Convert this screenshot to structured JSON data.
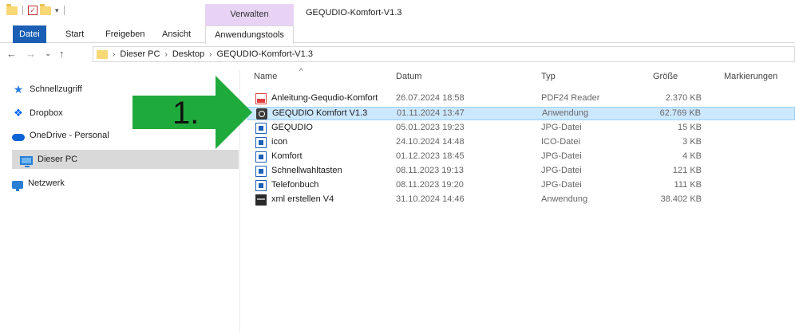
{
  "titlebar": {
    "verwalten": "Verwalten",
    "title": "GEQUDIO-Komfort-V1.3"
  },
  "ribbon": {
    "tabs": [
      "Datei",
      "Start",
      "Freigeben",
      "Ansicht",
      "Anwendungstools"
    ]
  },
  "address": {
    "crumbs": [
      "Dieser PC",
      "Desktop",
      "GEQUDIO-Komfort-V1.3"
    ]
  },
  "sidebar": {
    "items": [
      {
        "label": "Schnellzugriff",
        "icon": "star-icon"
      },
      {
        "label": "Dropbox",
        "icon": "dropbox-icon"
      },
      {
        "label": "OneDrive - Personal",
        "icon": "cloud-icon"
      },
      {
        "label": "Dieser PC",
        "icon": "computer-icon",
        "selected": true
      },
      {
        "label": "Netzwerk",
        "icon": "network-icon"
      }
    ]
  },
  "columns": {
    "name": "Name",
    "date": "Datum",
    "type": "Typ",
    "size": "Größe",
    "tags": "Markierungen"
  },
  "files": [
    {
      "name": "Anleitung-Gequdio-Komfort",
      "date": "26.07.2024 18:58",
      "type": "PDF24 Reader",
      "size": "2.370 KB",
      "icon": "pdf-icon"
    },
    {
      "name": "GEQUDIO Komfort V1.3",
      "date": "01.11.2024 13:47",
      "type": "Anwendung",
      "size": "62.769 KB",
      "icon": "app-icon",
      "selected": true
    },
    {
      "name": "GEQUDIO",
      "date": "05.01.2023 19:23",
      "type": "JPG-Datei",
      "size": "15 KB",
      "icon": "image-icon"
    },
    {
      "name": "icon",
      "date": "24.10.2024 14:48",
      "type": "ICO-Datei",
      "size": "3 KB",
      "icon": "image-icon"
    },
    {
      "name": "Komfort",
      "date": "01.12.2023 18:45",
      "type": "JPG-Datei",
      "size": "4 KB",
      "icon": "image-icon"
    },
    {
      "name": "Schnellwahltasten",
      "date": "08.11.2023 19:13",
      "type": "JPG-Datei",
      "size": "121 KB",
      "icon": "image-icon"
    },
    {
      "name": "Telefonbuch",
      "date": "08.11.2023 19:20",
      "type": "JPG-Datei",
      "size": "111 KB",
      "icon": "image-icon"
    },
    {
      "name": "xml erstellen V4",
      "date": "31.10.2024 14:46",
      "type": "Anwendung",
      "size": "38.402 KB",
      "icon": "xml-app-icon"
    }
  ],
  "annotation": {
    "label": "1.",
    "color": "#1faa3c"
  },
  "colors": {
    "selection": "#cce8ff",
    "accent": "#1a5fb4",
    "verwalten": "#e8d3f5"
  }
}
